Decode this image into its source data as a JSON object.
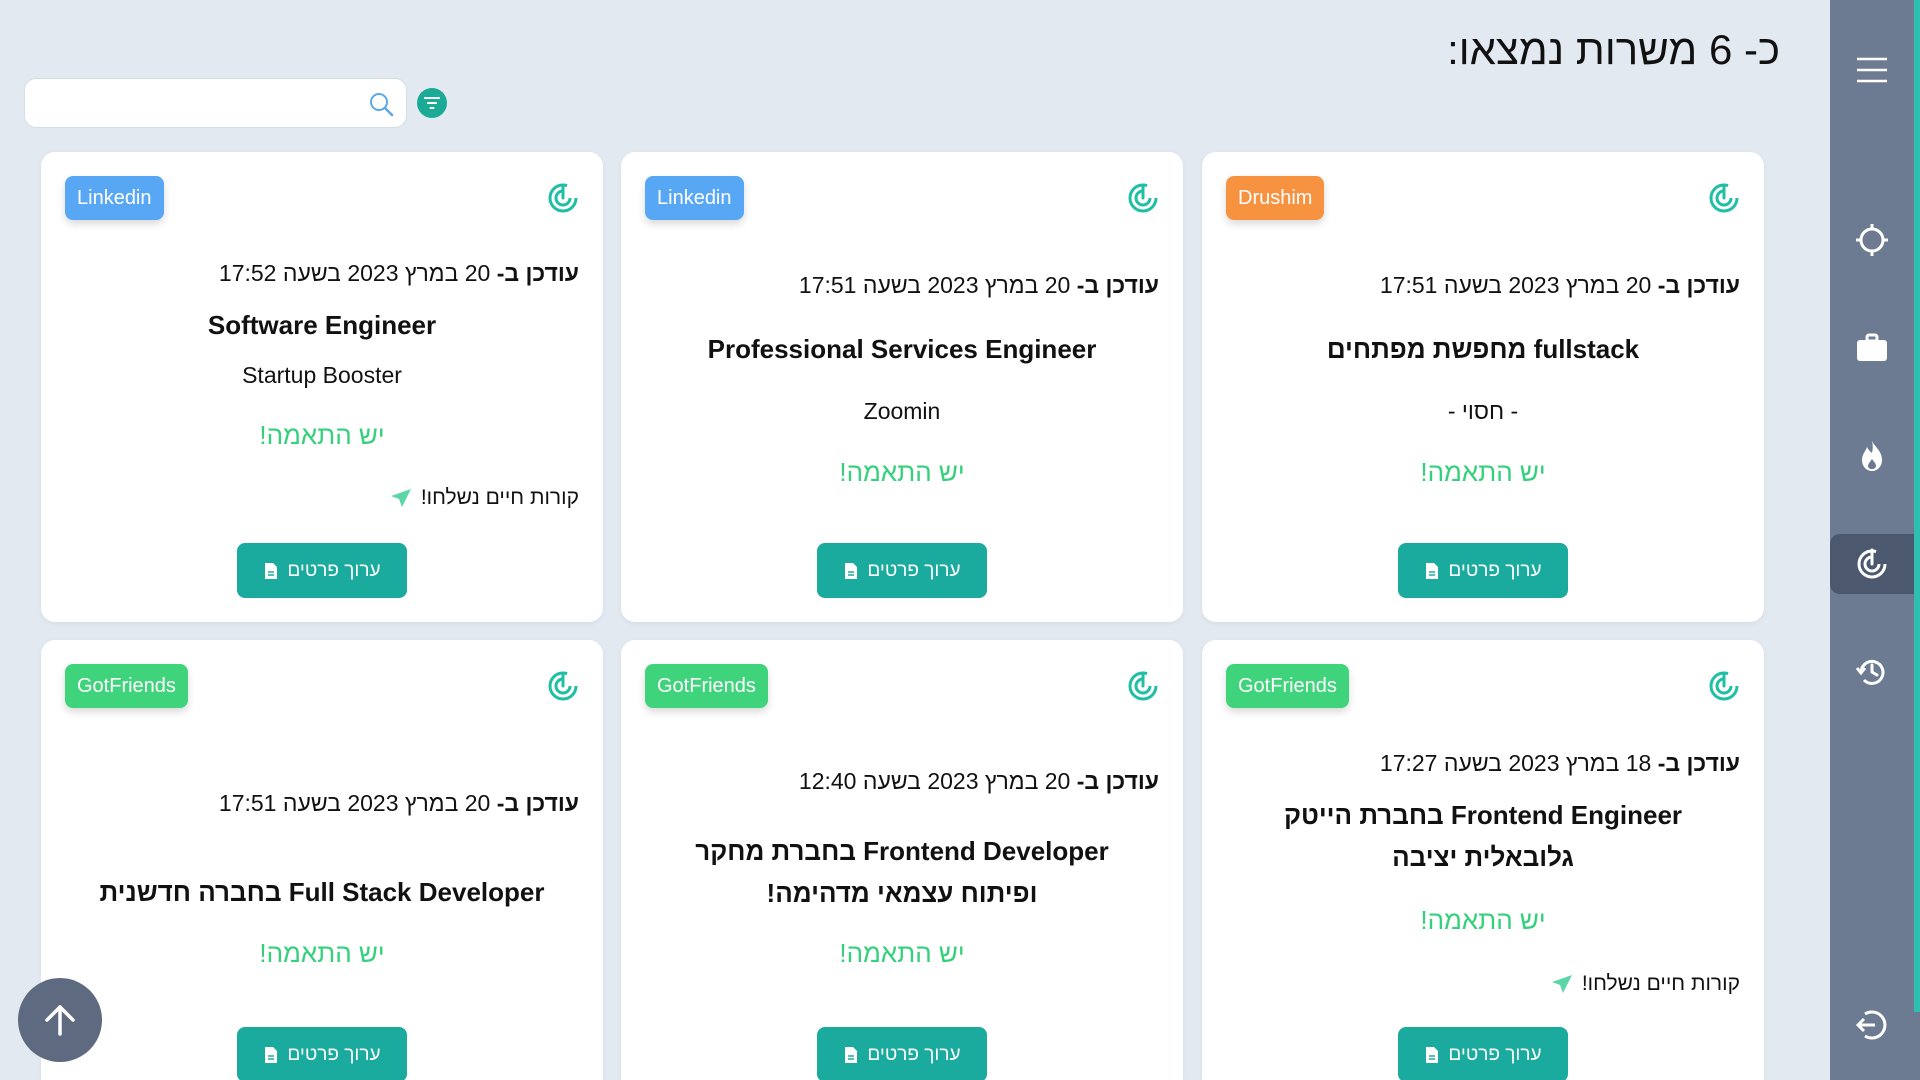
{
  "header": {
    "title": "כ- 6 משרות נמצאו:",
    "search_placeholder": ""
  },
  "colors": {
    "linkedin": "#58a7f5",
    "drushim": "#f79240",
    "gotfriends": "#3fd47b",
    "accent": "#1aaa9e",
    "match": "#35d07b"
  },
  "cards": [
    {
      "source": "Linkedin",
      "updated_prefix": "עודכן ב-",
      "updated_text": " 20 במרץ 2023 בשעה 17:52",
      "title": "Software Engineer",
      "company": "Startup Booster",
      "match": "יש התאמה!",
      "cv_sent": "קורות חיים נשלחו!",
      "button": "ערוך פרטים"
    },
    {
      "source": "Linkedin",
      "updated_prefix": "עודכן ב-",
      "updated_text": " 20 במרץ 2023 בשעה 17:51",
      "title": "Professional Services Engineer",
      "company": "Zoomin",
      "match": "יש התאמה!",
      "button": "ערוך פרטים"
    },
    {
      "source": "Drushim",
      "updated_prefix": "עודכן ב-",
      "updated_text": " 20 במרץ 2023 בשעה 17:51",
      "title": "fullstack מחפשת מפתחים",
      "company": "- חסוי -",
      "match": "יש התאמה!",
      "button": "ערוך פרטים"
    },
    {
      "source": "GotFriends",
      "updated_prefix": "עודכן ב-",
      "updated_text": " 20 במרץ 2023 בשעה 17:51",
      "title": "Full Stack Developer בחברה חדשנית",
      "match": "יש התאמה!",
      "button": "ערוך פרטים"
    },
    {
      "source": "GotFriends",
      "updated_prefix": "עודכן ב-",
      "updated_text": " 20 במרץ 2023 בשעה 12:40",
      "title": "Frontend Developer בחברת מחקר ופיתוח עצמאי מדהימה!",
      "match": "יש התאמה!",
      "button": "ערוך פרטים"
    },
    {
      "source": "GotFriends",
      "updated_prefix": "עודכן ב-",
      "updated_text": " 18 במרץ 2023 בשעה 17:27",
      "title": "Frontend Engineer בחברת הייטק גלובאלית יציבה",
      "match": "יש התאמה!",
      "cv_sent": "קורות חיים נשלחו!",
      "button": "ערוך פרטים"
    }
  ],
  "sidebar": {
    "items": [
      {
        "icon": "hamburger-menu-icon"
      },
      {
        "icon": "crosshair-icon"
      },
      {
        "icon": "briefcase-icon"
      },
      {
        "icon": "flame-icon"
      },
      {
        "icon": "radar-icon",
        "active": true
      },
      {
        "icon": "history-icon"
      },
      {
        "icon": "logout-icon"
      }
    ]
  }
}
